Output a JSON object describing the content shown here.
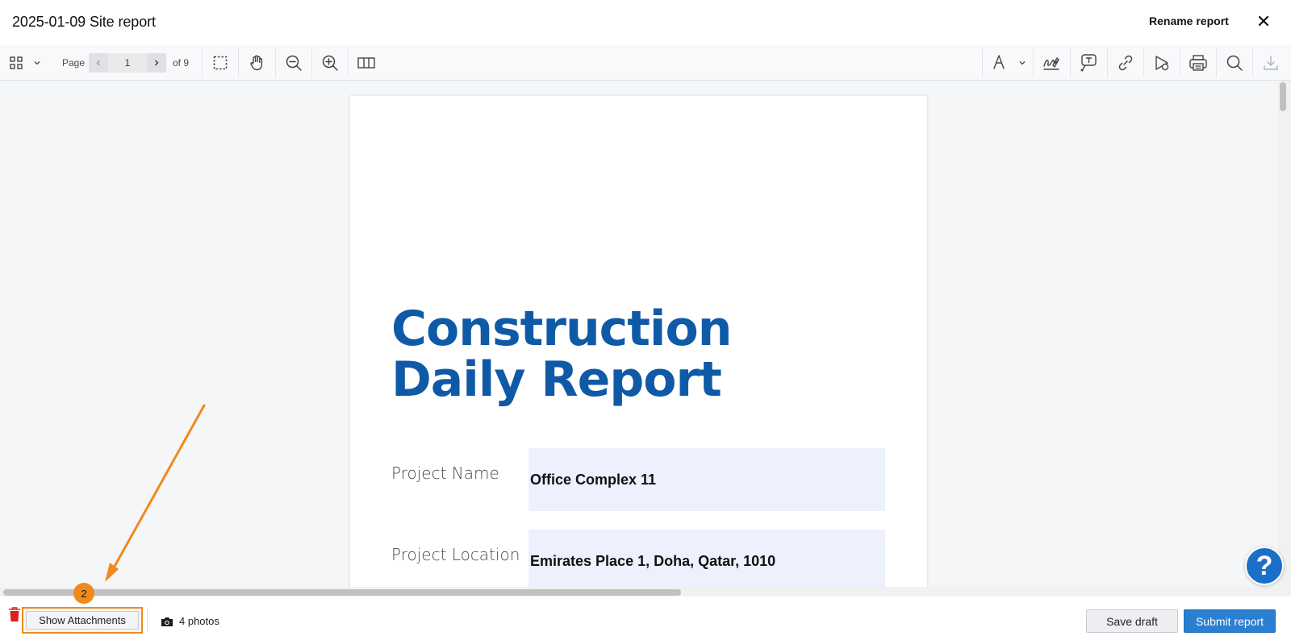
{
  "header": {
    "title": "2025-01-09 Site report",
    "rename_label": "Rename report"
  },
  "toolbar": {
    "page_label": "Page",
    "page_value": "1",
    "page_of": "of 9"
  },
  "document": {
    "title_line1": "Construction",
    "title_line2": "Daily Report",
    "fields": [
      {
        "label": "Project Name",
        "value": "Office Complex 11"
      },
      {
        "label": "Project Location",
        "value": "Emirates Place 1, Doha, Qatar, 1010"
      }
    ]
  },
  "help": {
    "label": "?"
  },
  "footer": {
    "show_attachments_label": "Show Attachments",
    "photos_label": "4 photos",
    "save_draft_label": "Save draft",
    "submit_label": "Submit report"
  },
  "annotation": {
    "step": "2"
  },
  "colors": {
    "accent": "#2b7fd1",
    "title_blue": "#0f5aa7",
    "annotation": "#f08a1c",
    "field_bg": "#edf0fd"
  }
}
